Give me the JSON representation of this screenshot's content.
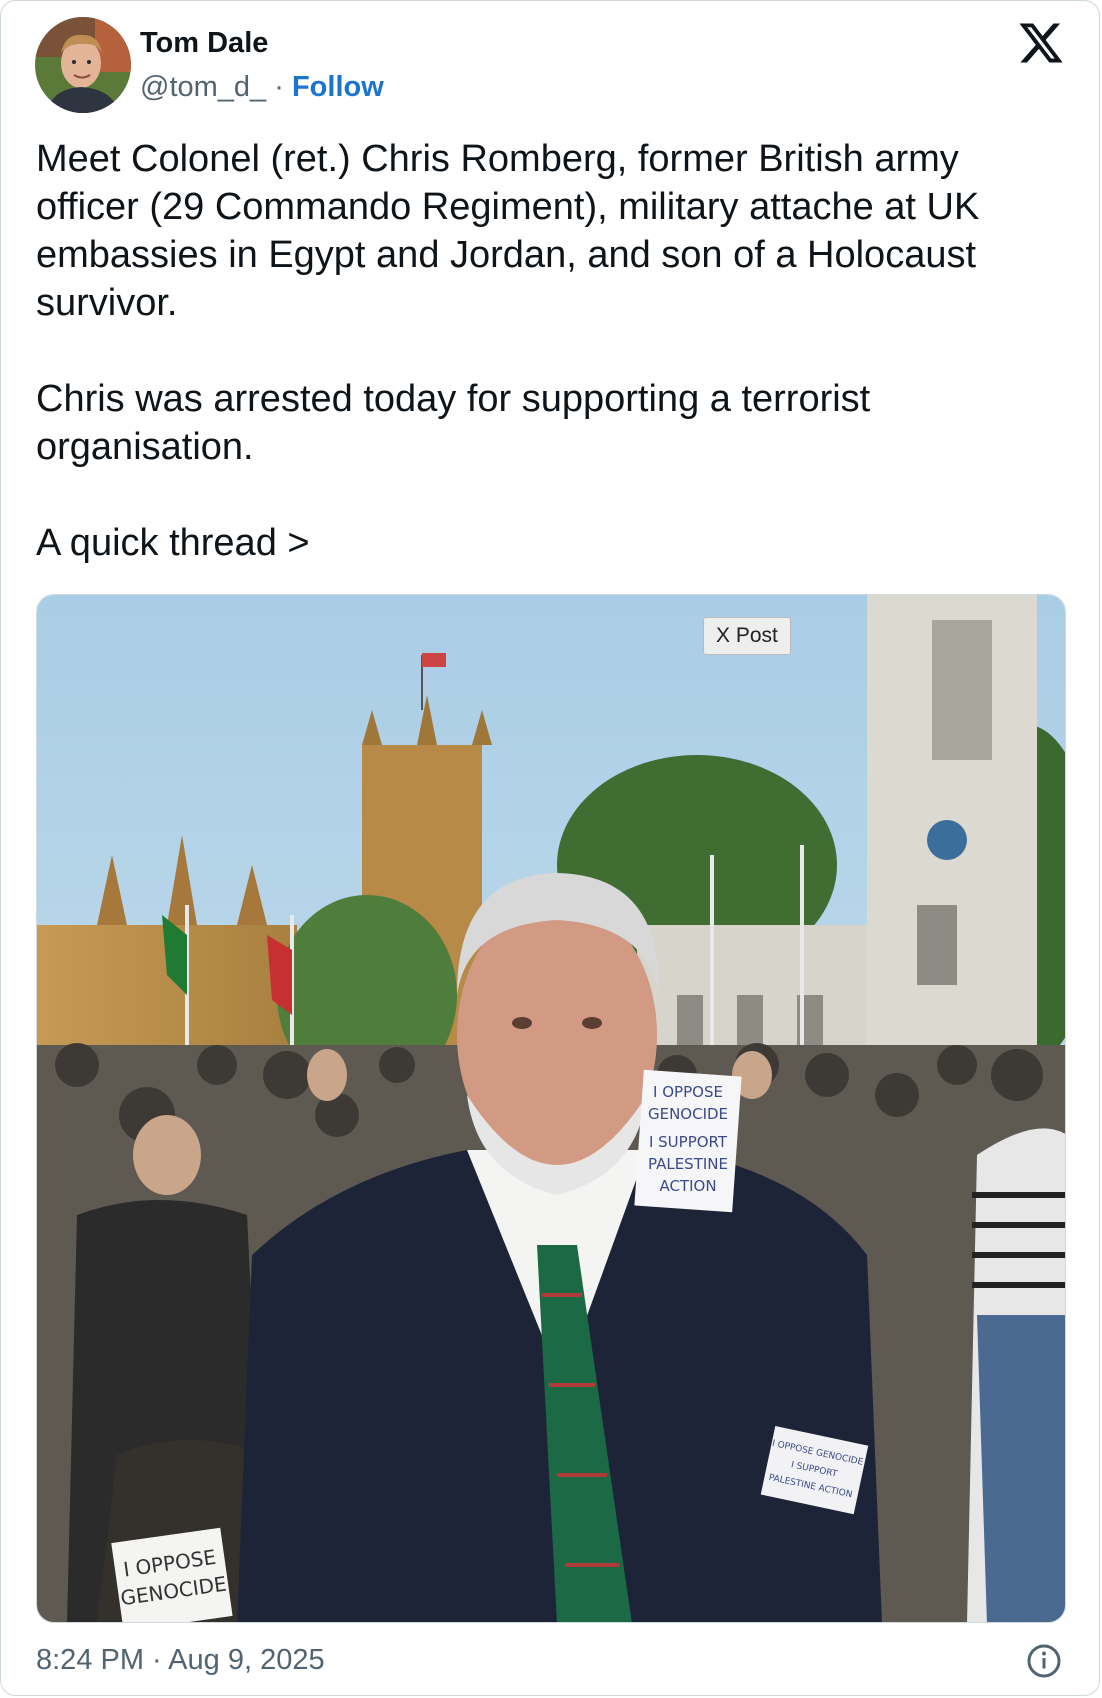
{
  "author": {
    "name": "Tom Dale",
    "handle": "@tom_d_",
    "separator": "·",
    "follow_label": "Follow"
  },
  "brand": {
    "logo_icon": "x-logo-icon"
  },
  "tweet": {
    "paragraphs": [
      "Meet Colonel (ret.) Chris Romberg, former British army officer (29 Commando Regiment), military attache at UK embassies in Egypt and Jordan, and son of a Holocaust survivor.",
      "Chris was arrested today for supporting a terrorist organisation.",
      "A quick thread >"
    ]
  },
  "media": {
    "badge": "X Post",
    "signs": {
      "center_line1": "I OPPOSE",
      "center_line2": "GENOCIDE",
      "center_line3": "I SUPPORT",
      "center_line4": "PALESTINE",
      "center_line5": "ACTION",
      "bottom_left_line1": "I OPPOSE",
      "bottom_left_line2": "GENOCIDE",
      "bottom_right_line1": "I OPPOSE GENOCIDE",
      "bottom_right_line2": "I SUPPORT",
      "bottom_right_line3": "PALESTINE ACTION"
    }
  },
  "footer": {
    "timestamp": "8:24 PM · Aug 9, 2025",
    "info_icon": "info-icon"
  },
  "colors": {
    "accent": "#1d74cf",
    "text": "#0f1419",
    "secondary": "#536471",
    "border": "#cfd9de"
  }
}
